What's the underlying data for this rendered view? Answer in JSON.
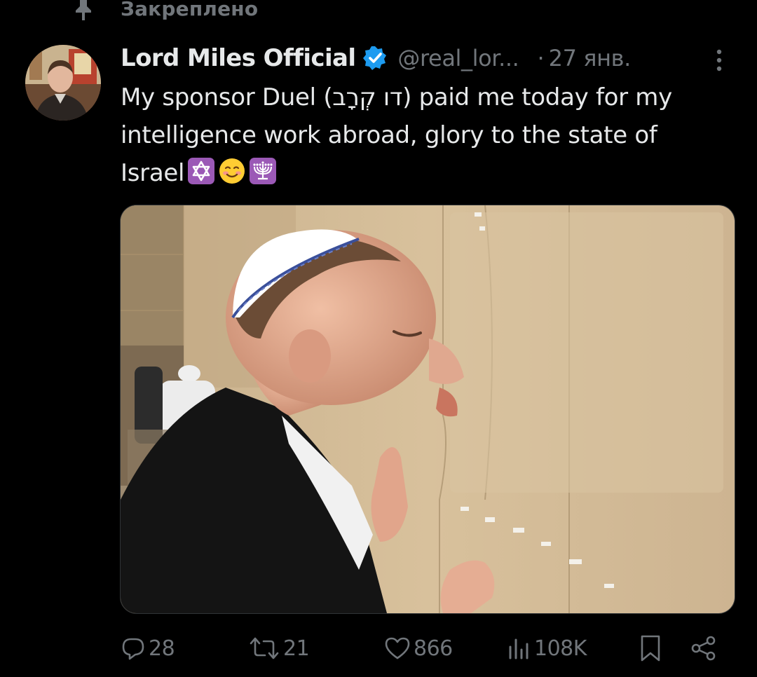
{
  "pinned": {
    "label": "Закреплено"
  },
  "author": {
    "display_name": "Lord Miles Official",
    "handle": "@real_lor...",
    "verified": true
  },
  "post": {
    "dot": "·",
    "date": "27 янв.",
    "text_lines": [
      "My sponsor Duel (דו קְרָב) paid me today for my",
      "intelligence work abroad, glory to the state of",
      "Israel"
    ],
    "emojis": [
      "star-of-david",
      "smiling-face",
      "menorah"
    ]
  },
  "actions": {
    "replies": "28",
    "reposts": "21",
    "likes": "866",
    "views": "108K"
  },
  "colors": {
    "background": "#000000",
    "text": "#e7e9ea",
    "muted": "#71767b",
    "verified": "#1d9bf0",
    "emoji_purple": "#9b59b6"
  }
}
